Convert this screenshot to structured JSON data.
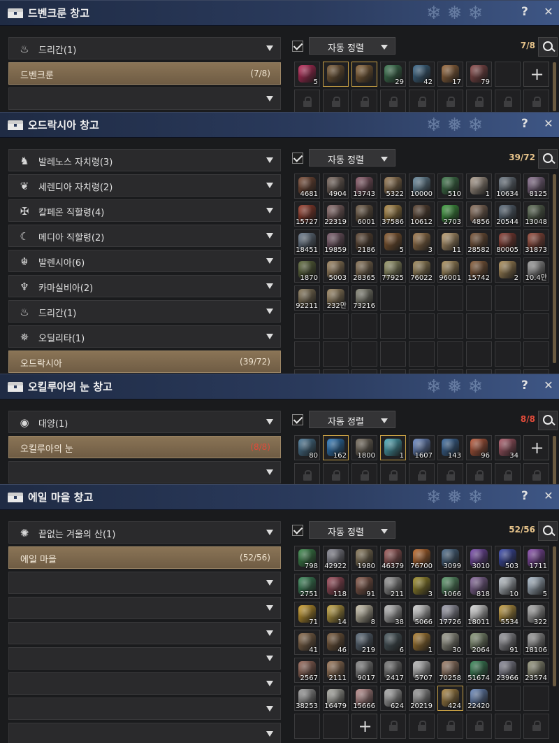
{
  "panels": [
    {
      "title": "드벤크룬 창고",
      "categories": [
        {
          "icon": "drigan-emblem-icon",
          "label": "드리간(1)"
        }
      ],
      "selected": {
        "label": "드벤크룬",
        "count": "(7/8)",
        "full": false
      },
      "empty_rows": 1,
      "sort_label": "자동 정렬",
      "capacity": "7/8",
      "capacity_full": false,
      "slots": [
        {
          "color": "#c0285a",
          "n": "5"
        },
        {
          "color": "#7a5a34",
          "n": "",
          "gold": true
        },
        {
          "color": "#8b6436",
          "n": "",
          "gold": true
        },
        {
          "color": "#3c7a52",
          "n": "29"
        },
        {
          "color": "#3c6a8c",
          "n": "42"
        },
        {
          "color": "#9c6a3c",
          "n": "17"
        },
        {
          "color": "#8c4a4a",
          "n": "79"
        },
        {
          "empty": true
        },
        {
          "add": true
        }
      ],
      "lock_count": 9
    },
    {
      "title": "오드락시아 창고",
      "categories": [
        {
          "icon": "horse-icon",
          "label": "발레노스 자치령(3)"
        },
        {
          "icon": "eagle-icon",
          "label": "세렌디아 자치령(2)"
        },
        {
          "icon": "wing-crest-icon",
          "label": "칼페온 직할령(4)"
        },
        {
          "icon": "moon-icon",
          "label": "메디아 직할령(2)"
        },
        {
          "icon": "scarab-icon",
          "label": "발렌시아(6)"
        },
        {
          "icon": "trident-icon",
          "label": "카마실비아(2)"
        },
        {
          "icon": "drigan-emblem-icon",
          "label": "드리간(1)"
        },
        {
          "icon": "sun-crest-icon",
          "label": "오딜리타(1)"
        }
      ],
      "selected": {
        "label": "오드락시아",
        "count": "(39/72)",
        "full": false
      },
      "empty_rows": 0,
      "sort_label": "자동 정렬",
      "capacity": "39/72",
      "capacity_full": false,
      "slots": [
        {
          "color": "#7a4a34",
          "n": "4681"
        },
        {
          "color": "#7c6a60",
          "n": "4904"
        },
        {
          "color": "#8c5a6a",
          "n": "13743"
        },
        {
          "color": "#9a7a52",
          "n": "5322"
        },
        {
          "color": "#6a8ca0",
          "n": "10000"
        },
        {
          "color": "#3e7a4a",
          "n": "510"
        },
        {
          "color": "#b0a090",
          "n": "1"
        },
        {
          "color": "#6e7a86",
          "n": "10634"
        },
        {
          "color": "#8a7090",
          "n": "8125"
        },
        {
          "color": "#9c3c2a",
          "n": "15727"
        },
        {
          "color": "#8a6a6a",
          "n": "22319"
        },
        {
          "color": "#6e5a44",
          "n": "6001"
        },
        {
          "color": "#b08a44",
          "n": "37586"
        },
        {
          "color": "#5a4230",
          "n": "10612"
        },
        {
          "color": "#3ea03e",
          "n": "2703"
        },
        {
          "color": "#8a6e5a",
          "n": "4856"
        },
        {
          "color": "#5a6a7a",
          "n": "20544"
        },
        {
          "color": "#5a6a52",
          "n": "13048"
        },
        {
          "color": "#6a7a8c",
          "n": "18451"
        },
        {
          "color": "#7a5a6a",
          "n": "19859"
        },
        {
          "color": "#5e4632",
          "n": "2186"
        },
        {
          "color": "#8a5a2e",
          "n": "5"
        },
        {
          "color": "#a0784a",
          "n": "3"
        },
        {
          "color": "#c0a070",
          "n": "11"
        },
        {
          "color": "#7a5436",
          "n": "28582"
        },
        {
          "color": "#8a3a30",
          "n": "80005"
        },
        {
          "color": "#9a4a3a",
          "n": "31873"
        },
        {
          "color": "#5e6a3a",
          "n": "1870"
        },
        {
          "color": "#a08660",
          "n": "5003"
        },
        {
          "color": "#8a7456",
          "n": "28365"
        },
        {
          "color": "#9a9a6a",
          "n": "77925"
        },
        {
          "color": "#a08a5a",
          "n": "76022"
        },
        {
          "color": "#b09460",
          "n": "96001"
        },
        {
          "color": "#8a5e3a",
          "n": "15742"
        },
        {
          "color": "#b0905a",
          "n": "2"
        },
        {
          "color": "#a0a0a0",
          "n": "10.4만"
        },
        {
          "color": "#8a7a5a",
          "n": "92211"
        },
        {
          "color": "#a08a64",
          "n": "232만"
        },
        {
          "color": "#8a8a7a",
          "n": "73216"
        }
      ],
      "empty_count": 33,
      "lock_count": 0
    },
    {
      "title": "오킬루아의 눈 창고",
      "categories": [
        {
          "icon": "ocean-icon",
          "label": "대양(1)"
        }
      ],
      "selected": {
        "label": "오킬루아의 눈",
        "count": "(8/8)",
        "full": true
      },
      "empty_rows": 1,
      "sort_label": "자동 정렬",
      "capacity": "8/8",
      "capacity_full": true,
      "slots": [
        {
          "color": "#4a7a9a",
          "n": "80"
        },
        {
          "color": "#2a7ac0",
          "n": "162",
          "gold": true
        },
        {
          "color": "#7a7060",
          "n": "1800"
        },
        {
          "color": "#4ab0c0",
          "n": "1",
          "gold": true
        },
        {
          "color": "#6a8ac8",
          "n": "1607"
        },
        {
          "color": "#3a6aa0",
          "n": "143"
        },
        {
          "color": "#c05a3a",
          "n": "96"
        },
        {
          "color": "#b05a6a",
          "n": "34"
        },
        {
          "add": true
        }
      ],
      "lock_count": 9
    },
    {
      "title": "에일 마을 창고",
      "categories": [
        {
          "icon": "snowflake-crest-icon",
          "label": "끝없는 겨울의 산(1)"
        }
      ],
      "selected": {
        "label": "에일 마을",
        "count": "(52/56)",
        "full": false
      },
      "empty_rows": 7,
      "sort_label": "자동 정렬",
      "capacity": "52/56",
      "capacity_full": false,
      "slots": [
        {
          "color": "#3a8a4a",
          "n": "798"
        },
        {
          "color": "#8a8a96",
          "n": "42922"
        },
        {
          "color": "#8a7a5a",
          "n": "1980"
        },
        {
          "color": "#a05a5a",
          "n": "46379"
        },
        {
          "color": "#c06a2a",
          "n": "76700"
        },
        {
          "color": "#4a6a8a",
          "n": "3099"
        },
        {
          "color": "#7a4ab0",
          "n": "3010"
        },
        {
          "color": "#3a4ab0",
          "n": "503"
        },
        {
          "color": "#8a4ab0",
          "n": "1711"
        },
        {
          "color": "#3a8a5a",
          "n": "2751"
        },
        {
          "color": "#a04a5a",
          "n": "118"
        },
        {
          "color": "#8a5a4a",
          "n": "91"
        },
        {
          "color": "#9a9a9a",
          "n": "211"
        },
        {
          "color": "#a0902a",
          "n": "3"
        },
        {
          "color": "#5a9a6a",
          "n": "1066"
        },
        {
          "color": "#8a6aa0",
          "n": "818"
        },
        {
          "color": "#c0c8d0",
          "n": "10"
        },
        {
          "color": "#b0c0d0",
          "n": "5"
        },
        {
          "color": "#d0a02a",
          "n": "71"
        },
        {
          "color": "#c8a840",
          "n": "14"
        },
        {
          "color": "#d0c8b0",
          "n": "8"
        },
        {
          "color": "#c0c0c0",
          "n": "38"
        },
        {
          "color": "#d8d8d8",
          "n": "5066"
        },
        {
          "color": "#a0a0b0",
          "n": "17726"
        },
        {
          "color": "#e0e0e0",
          "n": "18011"
        },
        {
          "color": "#c8a040",
          "n": "5534"
        },
        {
          "color": "#b0b0b0",
          "n": "322"
        },
        {
          "color": "#8a6a4a",
          "n": "41"
        },
        {
          "color": "#7a5a3a",
          "n": "46"
        },
        {
          "color": "#5a6a7a",
          "n": "219"
        },
        {
          "color": "#4a5a60",
          "n": "6"
        },
        {
          "color": "#b08030",
          "n": "1"
        },
        {
          "color": "#a0a090",
          "n": "30"
        },
        {
          "color": "#8a9a7a",
          "n": "2064"
        },
        {
          "color": "#9a9aa0",
          "n": "91"
        },
        {
          "color": "#a0a0a0",
          "n": "18106"
        },
        {
          "color": "#9a6a5a",
          "n": "2567"
        },
        {
          "color": "#a07a5a",
          "n": "2111"
        },
        {
          "color": "#8a8a8a",
          "n": "9017"
        },
        {
          "color": "#7a7a7a",
          "n": "2417"
        },
        {
          "color": "#c0c0c0",
          "n": "5707"
        },
        {
          "color": "#a0806a",
          "n": "70258"
        },
        {
          "color": "#3a8a5a",
          "n": "51674"
        },
        {
          "color": "#8a8a9a",
          "n": "23966"
        },
        {
          "color": "#9a9a80",
          "n": "23574"
        },
        {
          "color": "#a0a0a0",
          "n": "38253"
        },
        {
          "color": "#b0b0a8",
          "n": "16479"
        },
        {
          "color": "#c09090",
          "n": "15666"
        },
        {
          "color": "#b0b0b0",
          "n": "624"
        },
        {
          "color": "#a0a0a0",
          "n": "20219"
        },
        {
          "color": "#b08a44",
          "n": "424",
          "gold": true
        },
        {
          "color": "#6a8ac0",
          "n": "22420"
        },
        {
          "empty": true
        },
        {
          "empty": true
        },
        {
          "empty": true
        },
        {
          "empty": true
        },
        {
          "add": true
        }
      ],
      "lock_count": 6
    }
  ]
}
